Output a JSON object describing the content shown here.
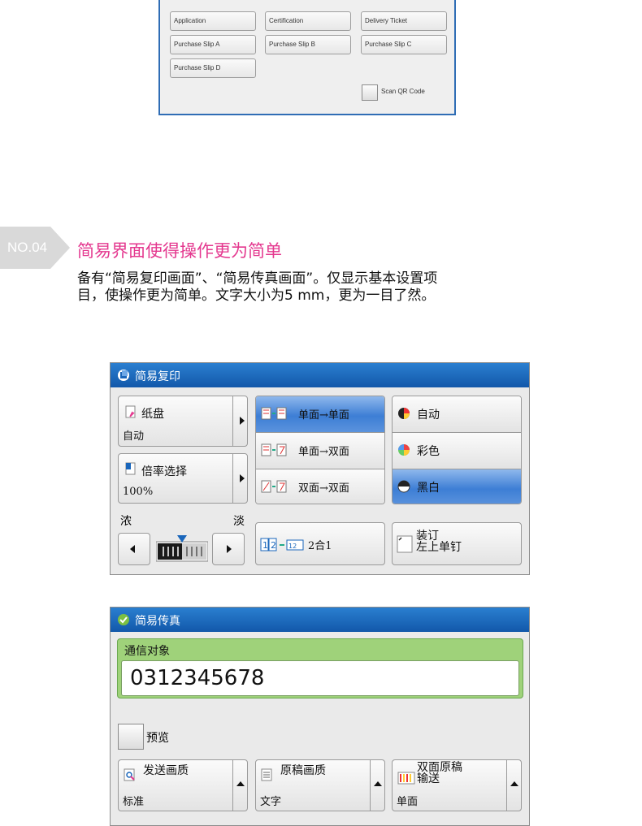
{
  "doc_buttons": {
    "application": "Application",
    "certification": "Certification",
    "delivery_ticket": "Delivery Ticket",
    "purchase_a": "Purchase Slip A",
    "purchase_b": "Purchase Slip B",
    "purchase_c": "Purchase Slip C",
    "purchase_d": "Purchase Slip D",
    "scan_qr": "Scan QR Code"
  },
  "section": {
    "badge": "NO.04",
    "title": "简易界面使得操作更为简单",
    "desc_line1": "备有“简易复印画面”、“简易传真画面”。仅显示基本设置项",
    "desc_line2": "目，使操作更为简单。文字大小为5 mm，更为一目了然。"
  },
  "copy_panel": {
    "title": "简易复印",
    "paper_label": "纸盘",
    "paper_value": "自动",
    "ratio_label": "倍率选择",
    "ratio_value": "100%",
    "density_dark": "浓",
    "density_light": "淡",
    "duplex_options": [
      "单面→单面",
      "单面→双面",
      "双面→双面"
    ],
    "color_options": [
      "自动",
      "彩色",
      "黑白"
    ],
    "nup_label": "2合1",
    "staple_label_1": "装订",
    "staple_label_2": "左上单钉",
    "density_level": 0.5
  },
  "fax_panel": {
    "title": "简易传真",
    "recipient_label": "通信对象",
    "recipient_value": "0312345678",
    "preview_label": "预览",
    "quality_label": "发送画质",
    "quality_value": "标准",
    "original_label": "原稿画质",
    "original_value": "文字",
    "duplex_label_1": "双面原稿",
    "duplex_label_2": "输送",
    "duplex_value": "单面"
  },
  "colors": {
    "accent_pink": "#e4388f",
    "header_blue": "#1a66bb",
    "selected_blue": "#4a86d8",
    "fax_green": "#9fd27a"
  }
}
